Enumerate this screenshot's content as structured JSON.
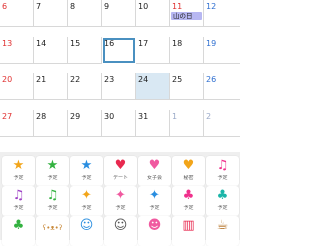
{
  "calendar": {
    "weeks": [
      [
        {
          "day": "6",
          "kind": "sun"
        },
        {
          "day": "7"
        },
        {
          "day": "8"
        },
        {
          "day": "9"
        },
        {
          "day": "10"
        },
        {
          "day": "11",
          "kind": "holiday",
          "event": "山の日"
        },
        {
          "day": "12",
          "kind": "sat"
        }
      ],
      [
        {
          "day": "13",
          "kind": "sun"
        },
        {
          "day": "14"
        },
        {
          "day": "15"
        },
        {
          "day": "16",
          "state": "selected"
        },
        {
          "day": "17"
        },
        {
          "day": "18"
        },
        {
          "day": "19",
          "kind": "sat"
        }
      ],
      [
        {
          "day": "20",
          "kind": "sun"
        },
        {
          "day": "21"
        },
        {
          "day": "22"
        },
        {
          "day": "23"
        },
        {
          "day": "24",
          "state": "today"
        },
        {
          "day": "25"
        },
        {
          "day": "26",
          "kind": "sat"
        }
      ],
      [
        {
          "day": "27",
          "kind": "sun"
        },
        {
          "day": "28"
        },
        {
          "day": "29"
        },
        {
          "day": "30"
        },
        {
          "day": "31"
        },
        {
          "day": "1",
          "kind": "muted"
        },
        {
          "day": "2",
          "kind": "muted"
        }
      ]
    ]
  },
  "stickers": [
    [
      {
        "icon": "star-icon",
        "glyph": "★",
        "color": "#f2a51a",
        "label": "予定"
      },
      {
        "icon": "star-icon",
        "glyph": "★",
        "color": "#33b240",
        "label": "予定"
      },
      {
        "icon": "star-icon",
        "glyph": "★",
        "color": "#2a8ee0",
        "label": "予定"
      },
      {
        "icon": "heart-icon",
        "glyph": "♥",
        "color": "#e8294f",
        "label": "デート"
      },
      {
        "icon": "heart-icon",
        "glyph": "♥",
        "color": "#f05aa0",
        "label": "女子会"
      },
      {
        "icon": "heart-icon",
        "glyph": "♥",
        "color": "#f2a51a",
        "label": "秘密"
      },
      {
        "icon": "music-note-icon",
        "glyph": "♫",
        "color": "#f0308c",
        "label": "予定"
      }
    ],
    [
      {
        "icon": "music-note-icon",
        "glyph": "♫",
        "color": "#9c3fc4",
        "label": "予定"
      },
      {
        "icon": "music-note-icon",
        "glyph": "♫",
        "color": "#33b240",
        "label": "予定"
      },
      {
        "icon": "sparkle-icon",
        "glyph": "✦",
        "color": "#f2a51a",
        "label": "予定"
      },
      {
        "icon": "sparkle-icon",
        "glyph": "✦",
        "color": "#f05aa0",
        "label": "予定"
      },
      {
        "icon": "sparkle-icon",
        "glyph": "✦",
        "color": "#2a8ee0",
        "label": "予定"
      },
      {
        "icon": "clover-icon",
        "glyph": "♣",
        "color": "#f0308c",
        "label": "予定"
      },
      {
        "icon": "clover-icon",
        "glyph": "♣",
        "color": "#1bb5a8",
        "label": "予定"
      }
    ],
    [
      {
        "icon": "clover-icon",
        "glyph": "♣",
        "color": "#33b240",
        "label": ""
      },
      {
        "icon": "bear-face-icon",
        "glyph": "ʕ•ᴥ•ʔ",
        "color": "#c98b3d",
        "label": ""
      },
      {
        "icon": "smiley-face-icon",
        "glyph": "☺",
        "color": "#2a8ee0",
        "label": ""
      },
      {
        "icon": "smiley-face-icon",
        "glyph": "☺",
        "color": "#555555",
        "label": ""
      },
      {
        "icon": "girl-face-icon",
        "glyph": "☻",
        "color": "#f05aa0",
        "label": ""
      },
      {
        "icon": "cake-icon",
        "glyph": "▥",
        "color": "#e8294f",
        "label": ""
      },
      {
        "icon": "coffee-cup-icon",
        "glyph": "☕",
        "color": "#b06a1a",
        "label": ""
      }
    ]
  ]
}
